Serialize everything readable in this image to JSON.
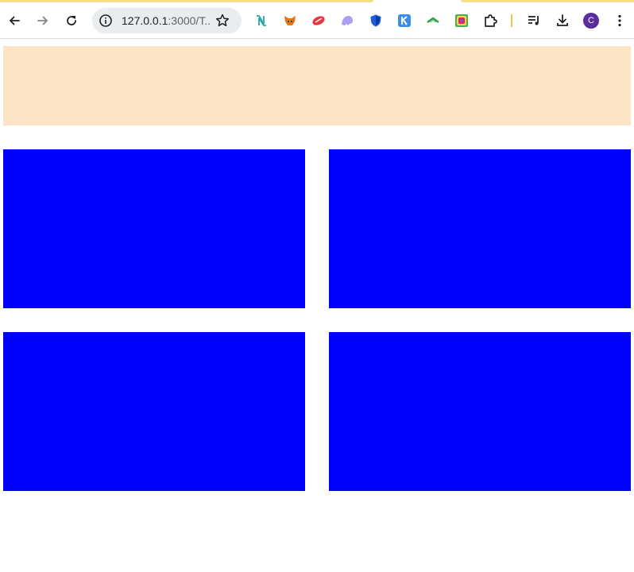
{
  "browser": {
    "url_host": "127.0.0.1",
    "url_rest": ":3000/T...",
    "avatar_letter": "C",
    "icons": {
      "back": "back-arrow-icon",
      "forward": "forward-arrow-icon",
      "reload": "reload-icon",
      "site_info": "info-icon",
      "bookmark": "star-icon",
      "extensions": [
        "notion-like-extension-icon",
        "metamask-fox-icon",
        "red-pill-extension-icon",
        "ghost-extension-icon",
        "shield-extension-icon",
        "k-extension-icon",
        "green-leaf-extension-icon",
        "colorful-box-extension-icon",
        "puzzle-extensions-icon"
      ],
      "media": "media-playlist-icon",
      "downloads": "download-icon",
      "menu": "kebab-menu-icon"
    }
  },
  "page": {
    "header_color": "#fde4c4",
    "box_color": "#0000ff",
    "boxes": [
      "box-1",
      "box-2",
      "box-3",
      "box-4"
    ]
  }
}
